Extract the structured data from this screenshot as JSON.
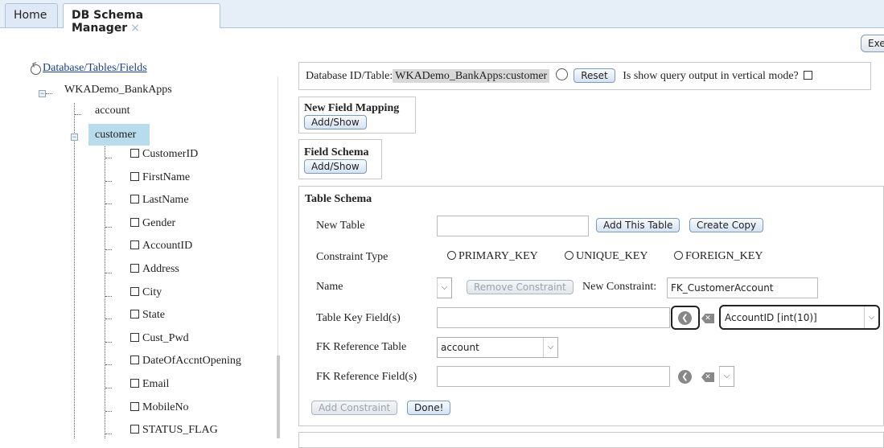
{
  "tabs": [
    {
      "label": "Home"
    },
    {
      "label": "DB Schema Manager",
      "close": "×"
    }
  ],
  "exec_button": "Exe",
  "tree": {
    "root_label": "Database/Tables/Fields",
    "database": "WKADemo_BankApps",
    "tables": [
      "account",
      "customer"
    ],
    "fields": [
      "CustomerID",
      "FirstName",
      "LastName",
      "Gender",
      "AccountID",
      "Address",
      "City",
      "State",
      "Cust_Pwd",
      "DateOfAccntOpening",
      "Email",
      "MobileNo",
      "STATUS_FLAG"
    ]
  },
  "db_panel": {
    "prefix": "Database ID/Table:",
    "table_value": "WKADemo_BankApps:customer",
    "reset": "Reset",
    "vertical_mode_label": "Is show query output in vertical mode?"
  },
  "new_field_mapping": {
    "title": "New Field Mapping",
    "button": "Add/Show"
  },
  "field_schema": {
    "title": "Field Schema",
    "button": "Add/Show"
  },
  "table_schema": {
    "title": "Table Schema",
    "new_table_label": "New Table",
    "add_table_button": "Add This Table",
    "create_copy_button": "Create Copy",
    "constraint_type_label": "Constraint Type",
    "constraint_types": [
      "PRIMARY_KEY",
      "UNIQUE_KEY",
      "FOREIGN_KEY"
    ],
    "name_label": "Name",
    "remove_constraint": "Remove Constraint",
    "new_constraint_label": "New Constraint:",
    "new_constraint_value": "FK_CustomerAccount",
    "table_key_label": "Table Key Field(s)",
    "table_key_select": "AccountID [int(10)]",
    "fk_ref_table_label": "FK Reference Table",
    "fk_ref_table_value": "account",
    "fk_ref_field_label": "FK Reference Field(s)",
    "add_constraint": "Add Constraint",
    "done": "Done!"
  }
}
